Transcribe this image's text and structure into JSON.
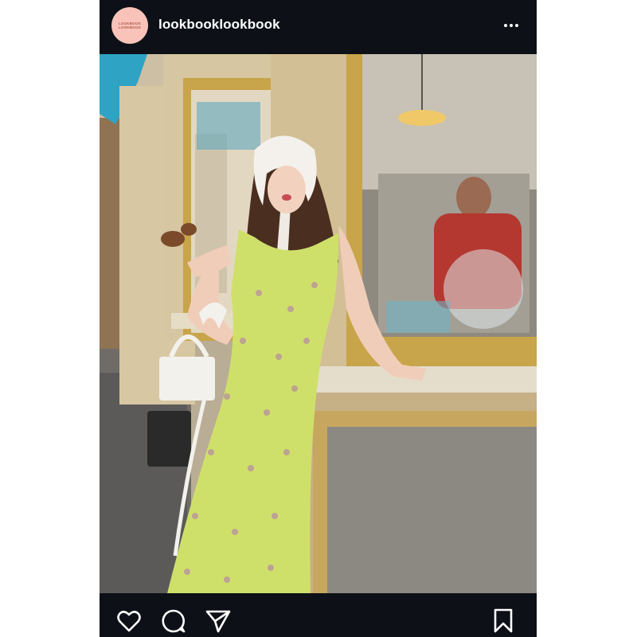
{
  "post": {
    "username": "lookbooklookbook",
    "avatar_text_line1": "LOOKBOOK",
    "avatar_text_line2": "LOOKBOOK",
    "more_icon": "more-horizontal-icon"
  },
  "actions": {
    "like_icon": "heart-icon",
    "comment_icon": "comment-icon",
    "share_icon": "send-icon",
    "save_icon": "bookmark-icon"
  },
  "colors": {
    "frame_background": "#0d1117",
    "avatar_background": "#f9c3b9",
    "dress": "#cfe06a",
    "awning": "#2ea3c4",
    "window_frame": "#c8a44a"
  }
}
